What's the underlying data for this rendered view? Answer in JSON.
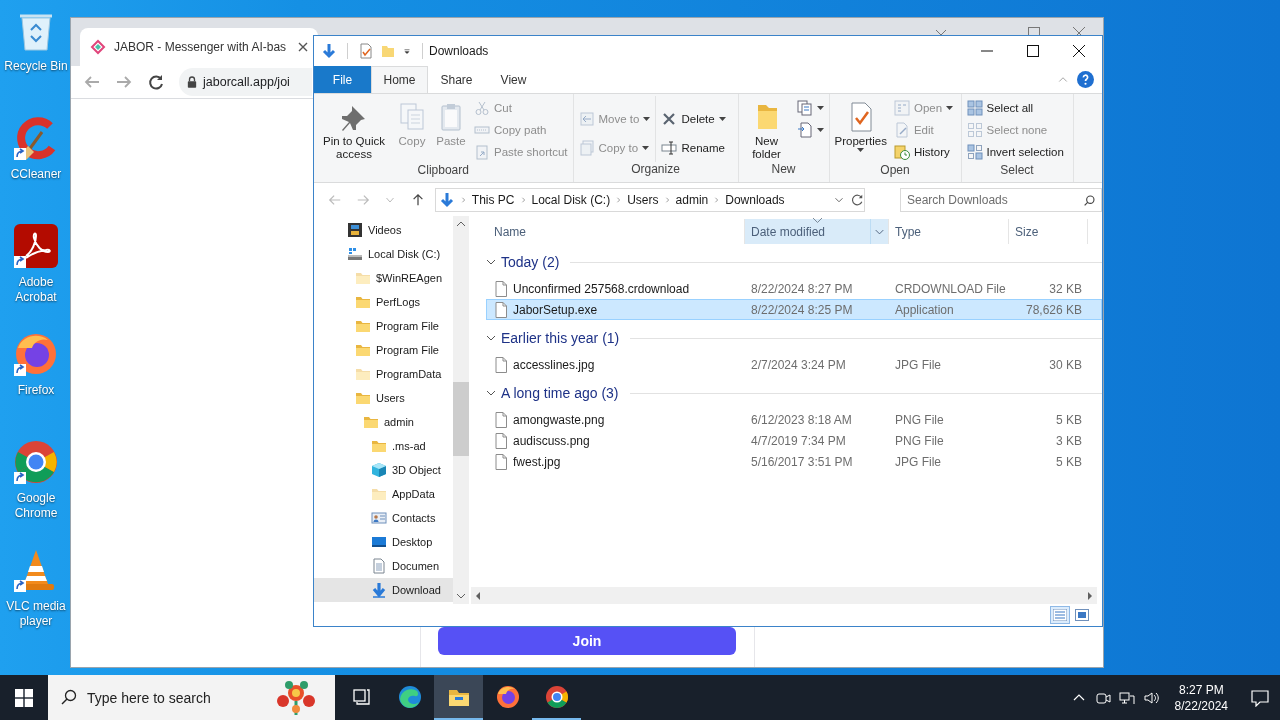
{
  "desktop": {
    "icons": [
      {
        "label": "Recycle Bin",
        "kind": "recycle",
        "shortcut": false
      },
      {
        "label": "CCleaner",
        "kind": "ccleaner",
        "shortcut": true
      },
      {
        "label": "Adobe Acrobat",
        "kind": "acrobat",
        "shortcut": true
      },
      {
        "label": "Firefox",
        "kind": "firefox",
        "shortcut": true
      },
      {
        "label": "Google Chrome",
        "kind": "chrome",
        "shortcut": true
      },
      {
        "label": "VLC media player",
        "kind": "vlc",
        "shortcut": true
      }
    ]
  },
  "browser": {
    "tab": {
      "title": "JABOR - Messenger with AI-bas",
      "selected": true
    },
    "address": "jaborcall.app/joi",
    "join_button": "Join"
  },
  "explorer": {
    "title": "Downloads",
    "ribbon_tabs": [
      {
        "label": "File",
        "kind": "file",
        "selected": false
      },
      {
        "label": "Home",
        "kind": "tab",
        "selected": true
      },
      {
        "label": "Share",
        "kind": "tab",
        "selected": false
      },
      {
        "label": "View",
        "kind": "tab",
        "selected": false
      }
    ],
    "ribbon_groups": [
      {
        "label": "Clipboard",
        "columns": [
          [
            {
              "label": "Pin to Quick access",
              "kind": "large",
              "disabled": false,
              "menu": false
            }
          ],
          [
            {
              "label": "Copy",
              "kind": "large",
              "disabled": true,
              "menu": false
            }
          ],
          [
            {
              "label": "Paste",
              "kind": "large",
              "disabled": true,
              "menu": false
            }
          ],
          [
            {
              "label": "Cut",
              "kind": "small",
              "disabled": true,
              "menu": false
            },
            {
              "label": "Copy path",
              "kind": "small",
              "disabled": true,
              "menu": false
            },
            {
              "label": "Paste shortcut",
              "kind": "small",
              "disabled": true,
              "menu": false
            }
          ]
        ]
      },
      {
        "label": "Organize",
        "columns": [
          [
            {
              "label": "Move to",
              "kind": "small",
              "disabled": true,
              "menu": true
            },
            {
              "label": "Copy to",
              "kind": "small",
              "disabled": true,
              "menu": true
            }
          ],
          [
            {
              "label": "Delete",
              "kind": "small",
              "disabled": false,
              "menu": true
            },
            {
              "label": "Rename",
              "kind": "small",
              "disabled": false,
              "menu": false
            }
          ]
        ]
      },
      {
        "label": "New",
        "columns": [
          [
            {
              "label": "New folder",
              "kind": "large",
              "disabled": false,
              "menu": false
            }
          ],
          [
            {
              "kind": "icon",
              "disabled": false,
              "menu": true
            },
            {
              "kind": "icon",
              "disabled": false,
              "menu": true
            }
          ]
        ]
      },
      {
        "label": "Open",
        "columns": [
          [
            {
              "label": "Properties",
              "kind": "large",
              "disabled": false,
              "menu": true
            }
          ],
          [
            {
              "label": "Open",
              "kind": "small",
              "disabled": true,
              "menu": true
            },
            {
              "label": "Edit",
              "kind": "small",
              "disabled": true,
              "menu": false
            },
            {
              "label": "History",
              "kind": "small",
              "disabled": false,
              "menu": false
            }
          ]
        ]
      },
      {
        "label": "Select",
        "columns": [
          [
            {
              "label": "Select all",
              "kind": "small",
              "disabled": false,
              "menu": false
            },
            {
              "label": "Select none",
              "kind": "small",
              "disabled": true,
              "menu": false
            },
            {
              "label": "Invert selection",
              "kind": "small",
              "disabled": false,
              "menu": false
            }
          ]
        ]
      }
    ],
    "crumbs": [
      "This PC",
      "Local Disk (C:)",
      "Users",
      "admin",
      "Downloads"
    ],
    "search_placeholder": "Search Downloads",
    "nav_tree": [
      {
        "label": "Videos",
        "kind": "videos",
        "hidden": false,
        "selected": false
      },
      {
        "label": "Local Disk (C:)",
        "kind": "disk",
        "hidden": false,
        "selected": false,
        "children": [
          {
            "label": "$WinREAgen",
            "kind": "folder",
            "hidden": true,
            "selected": false
          },
          {
            "label": "PerfLogs",
            "kind": "folder",
            "hidden": false,
            "selected": false
          },
          {
            "label": "Program File",
            "kind": "folder",
            "hidden": false,
            "selected": false
          },
          {
            "label": "Program File",
            "kind": "folder",
            "hidden": false,
            "selected": false
          },
          {
            "label": "ProgramData",
            "kind": "folder",
            "hidden": true,
            "selected": false
          },
          {
            "label": "Users",
            "kind": "folder",
            "hidden": false,
            "selected": false,
            "children": [
              {
                "label": "admin",
                "kind": "folder",
                "hidden": false,
                "selected": false,
                "children": [
                  {
                    "label": ".ms-ad",
                    "kind": "folder",
                    "hidden": false,
                    "selected": false
                  },
                  {
                    "label": "3D Object",
                    "kind": "objects3d",
                    "hidden": false,
                    "selected": false
                  },
                  {
                    "label": "AppData",
                    "kind": "folder",
                    "hidden": true,
                    "selected": false
                  },
                  {
                    "label": "Contacts",
                    "kind": "contacts",
                    "hidden": false,
                    "selected": false
                  },
                  {
                    "label": "Desktop",
                    "kind": "desktop",
                    "hidden": false,
                    "selected": false
                  },
                  {
                    "label": "Documen",
                    "kind": "documents",
                    "hidden": false,
                    "selected": false
                  },
                  {
                    "label": "Download",
                    "kind": "downloads",
                    "hidden": false,
                    "selected": true
                  }
                ]
              }
            ]
          }
        ]
      }
    ],
    "columns": [
      {
        "label": "Name",
        "sorted": false
      },
      {
        "label": "Date modified",
        "sorted": true
      },
      {
        "label": "Type",
        "sorted": false
      },
      {
        "label": "Size",
        "sorted": false
      }
    ],
    "groups": [
      {
        "label": "Today (2)",
        "expanded": true,
        "rows": [
          {
            "name": "Unconfirmed 257568.crdownload",
            "date": "8/22/2024 8:27 PM",
            "type": "CRDOWNLOAD File",
            "size": "32 KB",
            "selected": false
          },
          {
            "name": "JaborSetup.exe",
            "date": "8/22/2024 8:25 PM",
            "type": "Application",
            "size": "78,626 KB",
            "selected": true
          }
        ]
      },
      {
        "label": "Earlier this year (1)",
        "expanded": true,
        "rows": [
          {
            "name": "accesslines.jpg",
            "date": "2/7/2024 3:24 PM",
            "type": "JPG File",
            "size": "30 KB",
            "selected": false
          }
        ]
      },
      {
        "label": "A long time ago (3)",
        "expanded": true,
        "rows": [
          {
            "name": "amongwaste.png",
            "date": "6/12/2023 8:18 AM",
            "type": "PNG File",
            "size": "5 KB",
            "selected": false
          },
          {
            "name": "audiscuss.png",
            "date": "4/7/2019 7:34 PM",
            "type": "PNG File",
            "size": "3 KB",
            "selected": false
          },
          {
            "name": "fwest.jpg",
            "date": "5/16/2017 3:51 PM",
            "type": "JPG File",
            "size": "5 KB",
            "selected": false
          }
        ]
      }
    ],
    "views": [
      {
        "kind": "details",
        "selected": true
      },
      {
        "kind": "large-icons",
        "selected": false
      }
    ]
  },
  "taskbar": {
    "search_placeholder": "Type here to search",
    "apps": [
      {
        "kind": "taskview",
        "selected": false,
        "running": false
      },
      {
        "kind": "edge",
        "selected": false,
        "running": false
      },
      {
        "kind": "explorer",
        "selected": true,
        "running": true
      },
      {
        "kind": "firefox",
        "selected": false,
        "running": false
      },
      {
        "kind": "chrome",
        "selected": false,
        "running": true
      }
    ],
    "time": "8:27 PM",
    "date": "8/22/2024"
  }
}
